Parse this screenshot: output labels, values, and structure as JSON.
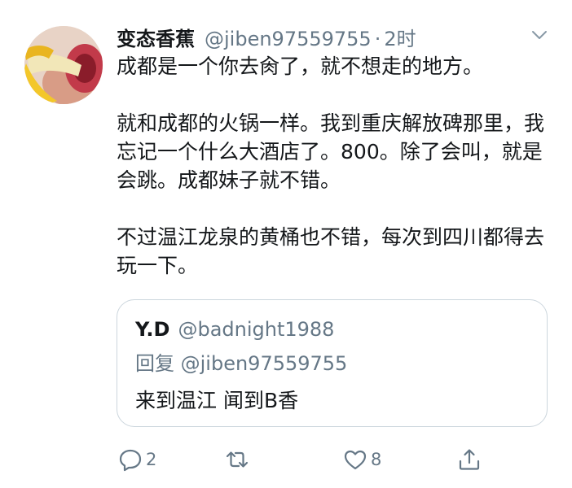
{
  "tweet": {
    "display_name": "变态香蕉",
    "handle": "@jiben97559755",
    "separator": "·",
    "time": "2时",
    "paragraphs": [
      "成都是一个你去肏了，就不想走的地方。",
      "就和成都的火锅一样。我到重庆解放碑那里，我忘记一个什么大酒店了。800。除了会叫，就是会跳。成都妹子就不错。",
      "不过温江龙泉的黄桶也不错，每次到四川都得去玩一下。"
    ]
  },
  "quote": {
    "display_name": "Y.D",
    "handle": "@badnight1988",
    "reply_to": "回复 @jiben97559755",
    "text": "来到温江 闻到B香"
  },
  "actions": {
    "reply_count": "2",
    "retweet_count": "",
    "like_count": "8"
  },
  "icons": {
    "caret": "chevron-down-icon",
    "reply": "reply-icon",
    "retweet": "retweet-icon",
    "like": "heart-icon",
    "share": "share-icon"
  },
  "colors": {
    "text": "#14171a",
    "secondary": "#657786",
    "border": "#ccd6dd"
  }
}
